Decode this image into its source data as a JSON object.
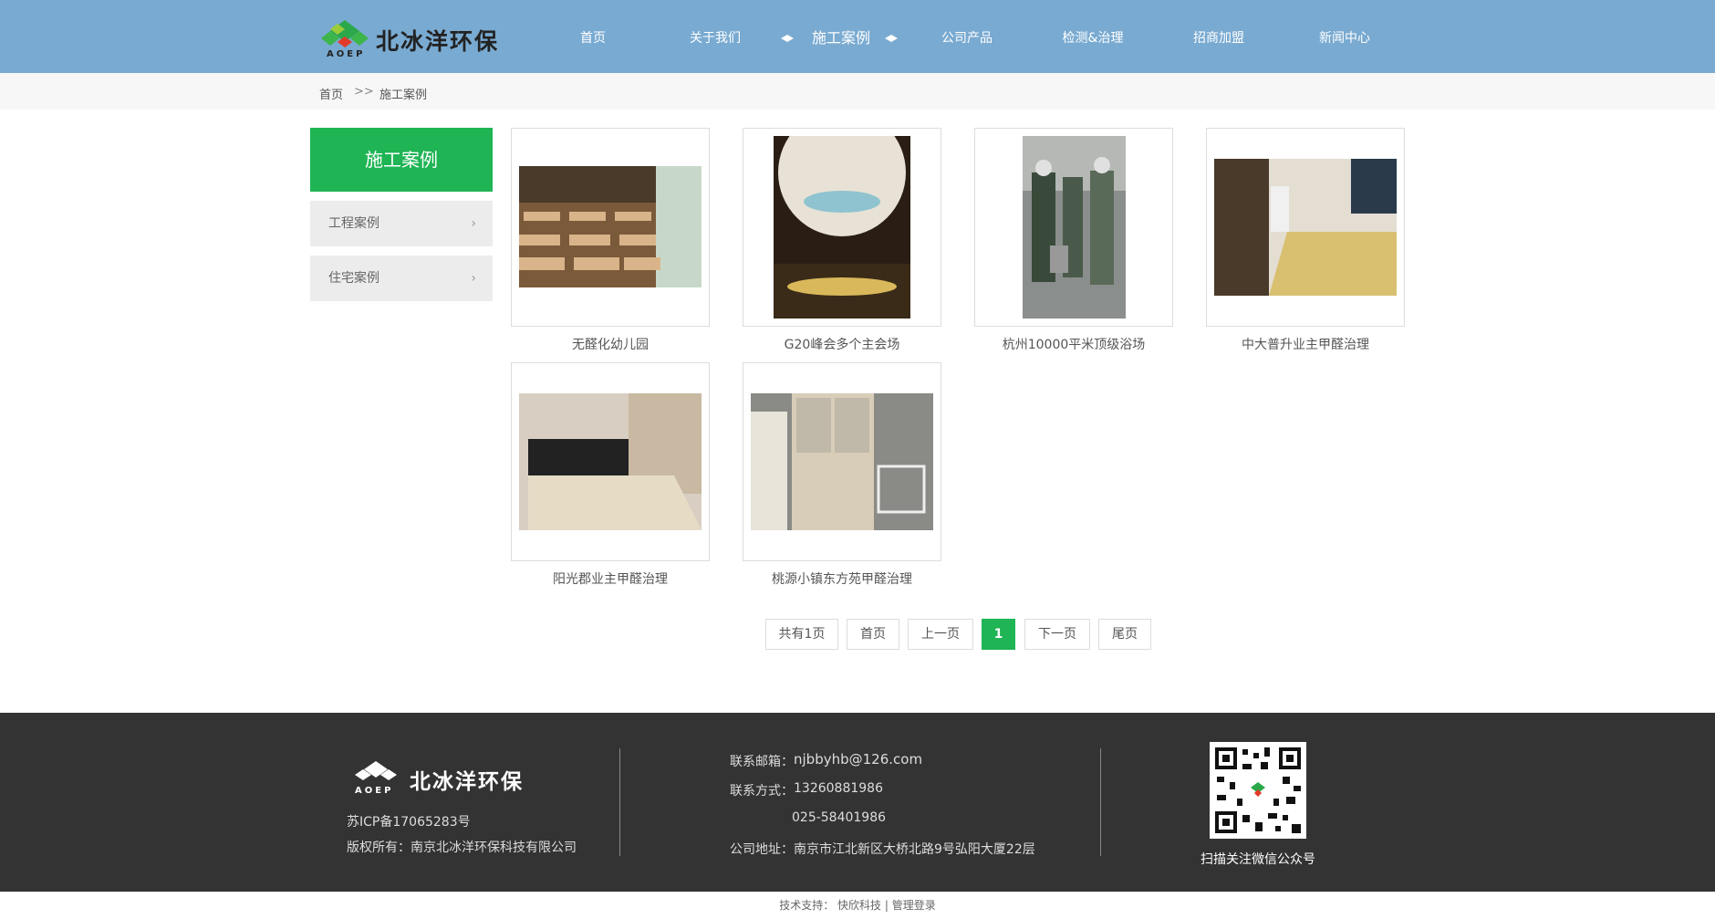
{
  "header": {
    "logo_text": "北冰洋环保",
    "logo_sub": "AOEP",
    "nav": [
      "首页",
      "关于我们",
      "施工案例",
      "公司产品",
      "检测&治理",
      "招商加盟",
      "新闻中心"
    ],
    "active_nav": "施工案例"
  },
  "breadcrumb": {
    "home": "首页",
    "separator": ">>",
    "current": "施工案例"
  },
  "sidebar": {
    "title": "施工案例",
    "items": [
      {
        "label": "工程案例"
      },
      {
        "label": "住宅案例"
      }
    ],
    "chevron": "›"
  },
  "cases": [
    {
      "caption": "无醛化幼儿园"
    },
    {
      "caption": "G20峰会多个主会场"
    },
    {
      "caption": "杭州10000平米顶级浴场"
    },
    {
      "caption": "中大普升业主甲醛治理"
    },
    {
      "caption": "阳光郡业主甲醛治理"
    },
    {
      "caption": "桃源小镇东方苑甲醛治理"
    }
  ],
  "pagination": {
    "total": "共有1页",
    "first": "首页",
    "prev": "上一页",
    "current": "1",
    "next": "下一页",
    "last": "尾页"
  },
  "footer": {
    "logo_text": "北冰洋环保",
    "logo_sub": "AOEP",
    "icp": "苏ICP备17065283号",
    "copyright": "版权所有：南京北冰洋环保科技有限公司",
    "email_label": "联系邮箱：",
    "email": "njbbyhb@126.com",
    "phone_label": "联系方式：",
    "phone1": "13260881986",
    "phone2": "025-58401986",
    "address_label": "公司地址：",
    "address": "南京市江北新区大桥北路9号弘阳大厦22层",
    "qr_caption": "扫描关注微信公众号"
  },
  "bottom": {
    "support_label": "技术支持：",
    "support": "快欣科技",
    "divider": "|",
    "admin": "管理登录"
  },
  "colors": {
    "header_bg": "#79aad1",
    "accent_green": "#1fb454",
    "footer_bg": "#333333"
  }
}
